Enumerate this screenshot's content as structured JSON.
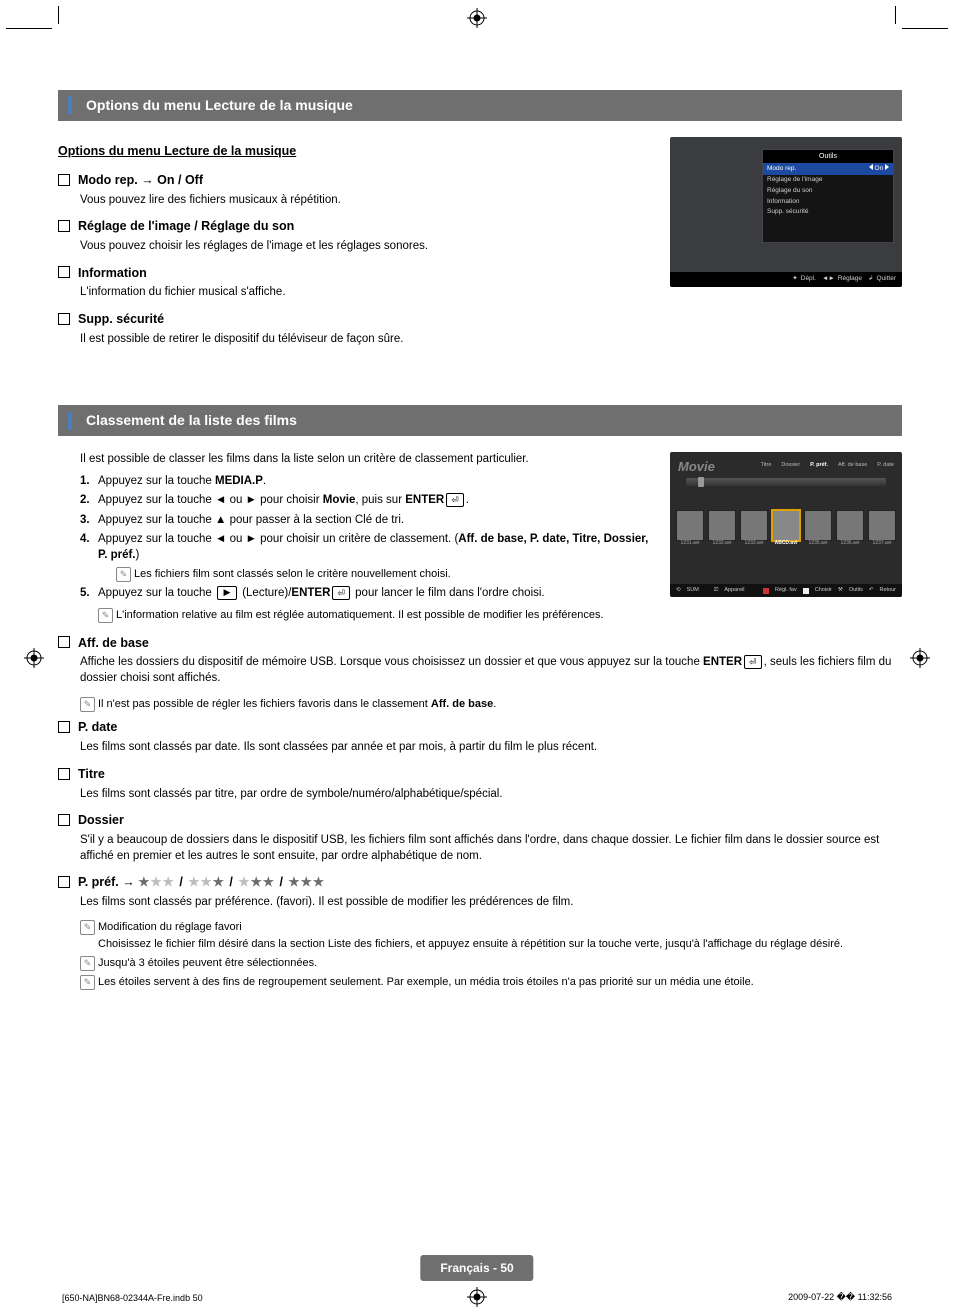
{
  "section1": {
    "heading": "Options du menu Lecture de la musique",
    "sub_heading": "Options du menu Lecture de la musique",
    "items": [
      {
        "title_pre": "Modo rep. → On / Off",
        "body": "Vous pouvez lire des fichiers musicaux à répétition."
      },
      {
        "title_pre": "Réglage de l'image / Réglage du son",
        "body": "Vous pouvez choisir les réglages de l'image et les réglages sonores."
      },
      {
        "title_pre": "Information",
        "body": "L'information du fichier musical s'affiche."
      },
      {
        "title_pre": "Supp. sécurité",
        "body": "Il est possible de retirer le dispositif du téléviseur de façon sûre."
      }
    ],
    "tools_panel": {
      "title": "Outils",
      "rows": [
        {
          "label": "Modo rep.",
          "left": "◄",
          "value": "On",
          "right": "►",
          "selected": true
        },
        {
          "label": "Réglage de l'image"
        },
        {
          "label": "Réglage du son"
        },
        {
          "label": "Information"
        },
        {
          "label": "Supp. sécurité"
        }
      ],
      "footer": [
        {
          "icon": "move",
          "label": "Dépl."
        },
        {
          "icon": "lr",
          "label": "Réglage"
        },
        {
          "icon": "back",
          "label": "Quitter"
        }
      ]
    }
  },
  "section2": {
    "heading": "Classement de la liste des films",
    "intro": "Il est possible de classer les films dans la liste selon un critère de classement particulier.",
    "steps": {
      "s1_a": "Appuyez sur la touche ",
      "s1_b": "MEDIA.P",
      "s1_c": ".",
      "s2_a": "Appuyez sur la touche ◄ ou ► pour choisir ",
      "s2_b": "Movie",
      "s2_c": ", puis sur ",
      "s2_d": "ENTER",
      "s2_e": ".",
      "s3": "Appuyez sur la touche ▲ pour passer à la section Clé de tri.",
      "s4_a": "Appuyez sur la touche ◄ ou ► pour choisir un critère de classement. (",
      "s4_b": "Aff. de base, P. date, Titre, Dossier, P. préf.",
      "s4_c": ")",
      "s4_note": "Les fichiers film sont classés selon le critère nouvellement choisi.",
      "s5_a": "Appuyez sur la touche ",
      "s5_play": "►",
      "s5_b": " (Lecture)/",
      "s5_c": "ENTER",
      "s5_d": " pour lancer le film dans l'ordre choisi.",
      "s5_note": "L'information relative au film est réglée automatiquement. Il est possible de modifier les préférences."
    },
    "movie_panel": {
      "title": "Movie",
      "tabs": [
        "Titre",
        "Dossier",
        "P. préf.",
        "Aff. de base",
        "P. date"
      ],
      "active_tab": "P. préf.",
      "sel_label": "ABCD.avi",
      "thumbs": [
        "1231.avi",
        "1232.avi",
        "1233.avi",
        "ABCD.avi",
        "1235.avi",
        "1236.avi",
        "1237.avi"
      ],
      "ftr_left": [
        "SUM",
        "Appareil"
      ],
      "ftr_right": [
        "Régl. fav",
        "Choisir",
        "Outils",
        "Retour"
      ]
    },
    "sort_options": [
      {
        "title": "Aff. de base",
        "body_a": "Affiche les dossiers du dispositif de mémoire USB. Lorsque vous choisissez un dossier et que vous appuyez sur la touche ",
        "body_b": "ENTER",
        "body_c": ", seuls les fichiers film du dossier choisi sont affichés.",
        "note_a": "Il n'est pas possible de régler les fichiers favoris dans le classement ",
        "note_b": "Aff. de base",
        "note_c": "."
      },
      {
        "title": "P. date",
        "body": "Les films sont classés par date. Ils sont classées par année et par mois, à partir du film le plus récent."
      },
      {
        "title": "Titre",
        "body": "Les films sont classés par titre, par ordre de symbole/numéro/alphabétique/spécial."
      },
      {
        "title": "Dossier",
        "body": "S'il y a beaucoup de dossiers dans le dispositif USB, les fichiers film sont affichés dans l'ordre, dans chaque dossier. Le fichier film dans le dossier source est affiché en premier et les autres le sont ensuite, par ordre alphabétique de nom."
      }
    ],
    "pref": {
      "title_pre": "P. préf. → ",
      "body": "Les films sont classés par préférence. (favori). Il est possible de modifier les prédérences de film.",
      "note1_t": "Modification du réglage favori",
      "note1_b": "Choisissez le fichier film désiré dans la section Liste des fichiers, et appuyez ensuite à répétition sur la touche verte, jusqu'à l'affichage du réglage désiré.",
      "note2": "Jusqu'à 3 étoiles peuvent être sélectionnées.",
      "note3": "Les étoiles servent à des fins de regroupement seulement. Par exemple, un média trois étoiles n'a pas priorité sur un média une étoile."
    }
  },
  "footer": {
    "badge": "Français - 50",
    "left": "[650-NA]BN68-02344A-Fre.indb   50",
    "right": "2009-07-22   �� 11:32:56"
  }
}
